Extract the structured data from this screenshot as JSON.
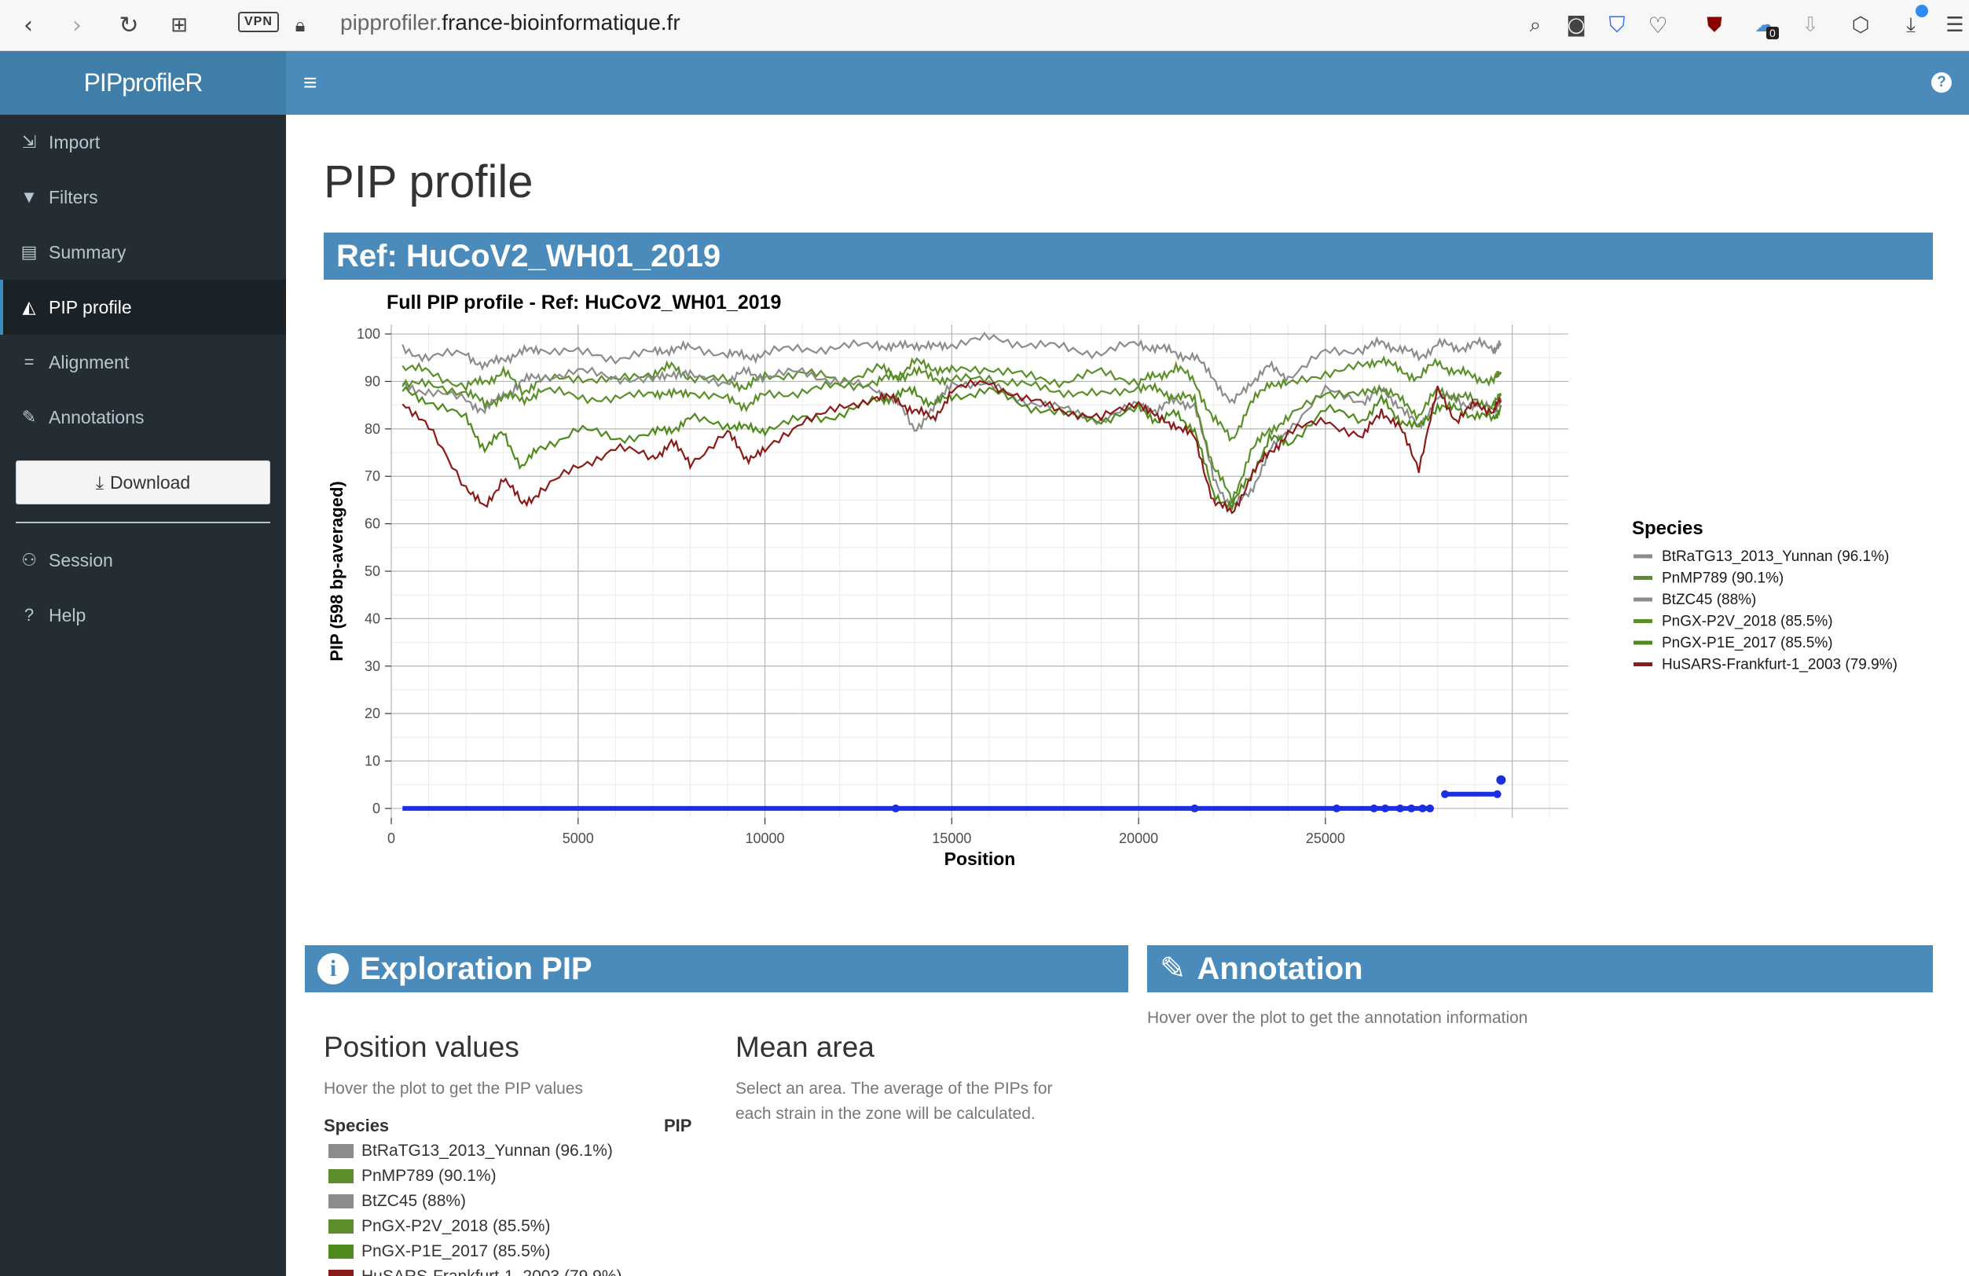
{
  "browser": {
    "url_host_dim": "pipprofiler.",
    "url_host": "france-bioinformatique.fr",
    "vpn_label": "VPN",
    "ext_badge": "0"
  },
  "app": {
    "logo": "PIPprofileR",
    "help_icon": "?"
  },
  "sidebar": {
    "items": [
      {
        "label": "Import",
        "icon": "import-icon"
      },
      {
        "label": "Filters",
        "icon": "filter-icon"
      },
      {
        "label": "Summary",
        "icon": "file-icon"
      },
      {
        "label": "PIP profile",
        "icon": "chart-area-icon"
      },
      {
        "label": "Alignment",
        "icon": "equals-icon"
      },
      {
        "label": "Annotations",
        "icon": "pencil-icon"
      }
    ],
    "download_label": "Download",
    "bottom_items": [
      {
        "label": "Session",
        "icon": "users-icon"
      },
      {
        "label": "Help",
        "icon": "question-circle-icon"
      }
    ]
  },
  "main": {
    "title": "PIP profile",
    "ref_title": "Ref: HuCoV2_WH01_2019"
  },
  "chart_data": {
    "type": "line",
    "title": "Full PIP profile - Ref: HuCoV2_WH01_2019",
    "xlabel": "Position",
    "ylabel": "PIP (598 bp-averaged)",
    "xlim": [
      0,
      31500
    ],
    "ylim": [
      -2,
      102
    ],
    "xticks": [
      0,
      5000,
      10000,
      15000,
      20000,
      25000
    ],
    "yticks": [
      0,
      10,
      20,
      30,
      40,
      50,
      60,
      70,
      80,
      90,
      100
    ],
    "grid": true,
    "legend_title": "Species",
    "legend_position": "right",
    "x": [
      300,
      1000,
      2000,
      2500,
      3000,
      3500,
      4000,
      5000,
      6000,
      7000,
      7500,
      8000,
      9000,
      9500,
      10000,
      11000,
      12000,
      13000,
      13500,
      14000,
      14500,
      15000,
      16000,
      17000,
      18000,
      19000,
      20000,
      20500,
      21000,
      21500,
      22000,
      22500,
      23000,
      23500,
      24000,
      25000,
      26000,
      26500,
      27000,
      27500,
      28000,
      28500,
      29000,
      29500,
      29700
    ],
    "series": [
      {
        "name": "BtRaTG13_2013_Yunnan (96.1%)",
        "color": "#8c8c8c",
        "values": [
          97,
          95,
          96,
          93,
          95,
          96,
          97,
          96,
          95,
          96,
          97,
          97,
          96,
          95,
          96,
          97,
          97,
          98,
          97,
          98,
          97,
          98,
          99,
          98,
          97,
          96,
          98,
          97,
          96,
          95,
          91,
          85,
          90,
          93,
          91,
          96,
          97,
          98,
          97,
          95,
          98,
          97,
          98,
          97,
          98
        ]
      },
      {
        "name": "PnMP789 (90.1%)",
        "color": "#5a8f29",
        "values": [
          93,
          92,
          89,
          90,
          92,
          88,
          90,
          91,
          90,
          92,
          93,
          91,
          90,
          89,
          91,
          92,
          90,
          93,
          91,
          94,
          93,
          92,
          93,
          91,
          90,
          92,
          90,
          91,
          93,
          90,
          82,
          78,
          85,
          90,
          89,
          92,
          93,
          95,
          92,
          91,
          94,
          92,
          91,
          90,
          92
        ]
      },
      {
        "name": "BtZC45 (88%)",
        "color": "#8c8c8c",
        "values": [
          89,
          88,
          86,
          84,
          87,
          90,
          91,
          92,
          91,
          90,
          92,
          91,
          90,
          92,
          91,
          92,
          90,
          88,
          86,
          80,
          84,
          90,
          89,
          86,
          84,
          82,
          85,
          84,
          86,
          85,
          70,
          63,
          67,
          75,
          80,
          88,
          86,
          88,
          85,
          80,
          87,
          86,
          85,
          84,
          86
        ]
      },
      {
        "name": "PnGX-P2V_2018 (85.5%)",
        "color": "#5a8f29",
        "values": [
          90,
          89,
          88,
          85,
          87,
          86,
          88,
          87,
          86,
          88,
          87,
          88,
          86,
          85,
          87,
          88,
          89,
          90,
          91,
          92,
          91,
          90,
          91,
          89,
          88,
          87,
          89,
          88,
          87,
          86,
          72,
          65,
          75,
          80,
          82,
          88,
          87,
          89,
          86,
          83,
          88,
          87,
          86,
          85,
          87
        ]
      },
      {
        "name": "PnGX-P1E_2017 (85.5%)",
        "color": "#4f8a1c",
        "values": [
          88,
          86,
          82,
          76,
          79,
          72,
          76,
          80,
          78,
          79,
          80,
          82,
          81,
          80,
          80,
          82,
          83,
          86,
          87,
          88,
          85,
          87,
          88,
          85,
          83,
          82,
          84,
          82,
          83,
          80,
          66,
          64,
          70,
          78,
          77,
          84,
          82,
          86,
          82,
          80,
          85,
          84,
          83,
          82,
          85
        ]
      },
      {
        "name": "HuSARS-Frankfurt-1_2003 (79.9%)",
        "color": "#8b1a1a",
        "values": [
          86,
          80,
          68,
          63,
          70,
          64,
          67,
          72,
          76,
          74,
          77,
          73,
          79,
          74,
          75,
          82,
          84,
          87,
          86,
          84,
          82,
          88,
          90,
          86,
          84,
          82,
          86,
          82,
          81,
          78,
          65,
          62,
          70,
          75,
          79,
          82,
          78,
          84,
          80,
          72,
          88,
          82,
          85,
          84,
          86
        ]
      }
    ],
    "annotation_track": {
      "color": "#1a2fe0",
      "line_y": 0,
      "x_start": 300,
      "x_end": 27800,
      "markers_x": [
        13500,
        21500,
        25300,
        26300,
        26600,
        27000,
        27300,
        27600,
        27800
      ],
      "segment2": {
        "x_start": 28200,
        "x_end": 29600,
        "y": 3
      },
      "end_marker": {
        "x": 29700,
        "y": 6
      }
    }
  },
  "exploration": {
    "header": "Exploration PIP",
    "header_icon": "i",
    "position_values_title": "Position values",
    "position_values_help": "Hover the plot to get the PIP values",
    "col_species": "Species",
    "col_pip": "PIP",
    "species": [
      {
        "name": "BtRaTG13_2013_Yunnan (96.1%)",
        "color": "#8c8c8c"
      },
      {
        "name": "PnMP789 (90.1%)",
        "color": "#5a8f29"
      },
      {
        "name": "BtZC45 (88%)",
        "color": "#8c8c8c"
      },
      {
        "name": "PnGX-P2V_2018 (85.5%)",
        "color": "#5a8f29"
      },
      {
        "name": "PnGX-P1E_2017 (85.5%)",
        "color": "#4f8a1c"
      },
      {
        "name": "HuSARS-Frankfurt-1_2003 (79.9%)",
        "color": "#8b1a1a"
      }
    ],
    "mean_area_title": "Mean area",
    "mean_area_help_1": "Select an area. The average of the PIPs for",
    "mean_area_help_2": "each strain in the zone will be calculated."
  },
  "annotation_box": {
    "header": "Annotation",
    "help": "Hover over the plot to get the annotation information"
  }
}
